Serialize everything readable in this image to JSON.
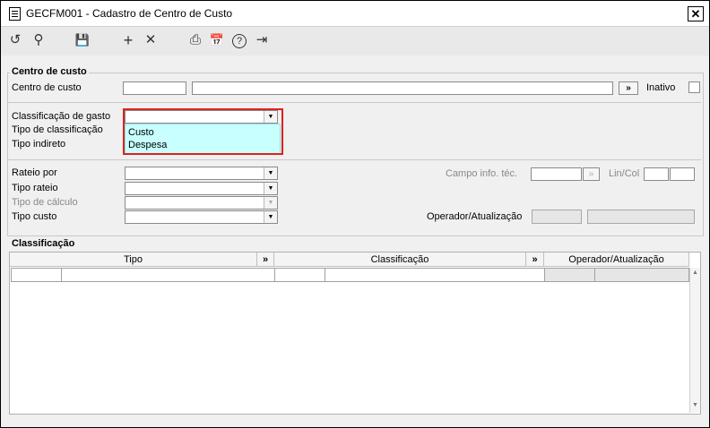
{
  "window": {
    "title": "GECFM001 - Cadastro de Centro de Custo",
    "close_label": "✕"
  },
  "toolbar": {
    "undo_icon": "↺",
    "search_icon": "⚲",
    "save_icon": "💾",
    "add_icon": "+",
    "delete_icon": "✕",
    "print_icon": "⎙",
    "calendar_icon": "📅",
    "help_icon": "?",
    "exit_icon": "⇥"
  },
  "centro": {
    "section_title": "Centro de custo",
    "label": "Centro de custo",
    "code_value": "",
    "description_value": "",
    "lookup_button": "»",
    "inativo_label": "Inativo"
  },
  "classificacao": {
    "gasto_label": "Classificação de gasto",
    "gasto_value": "",
    "tipo_label": "Tipo de classificação",
    "indireto_label": "Tipo indireto",
    "dropdown_options": [
      "Custo",
      "Despesa"
    ]
  },
  "rateio": {
    "rateio_por_label": "Rateio por",
    "tipo_rateio_label": "Tipo rateio",
    "tipo_calculo_label": "Tipo de cálculo",
    "tipo_custo_label": "Tipo custo",
    "campo_info_label": "Campo info. téc.",
    "campo_button": "»",
    "lincol_label": "Lin/Col",
    "operador_label": "Operador/Atualização"
  },
  "grid": {
    "section_title": "Classificação",
    "col_tipo": "Tipo",
    "col_lookup1": "»",
    "col_classificacao": "Classificação",
    "col_lookup2": "»",
    "col_operador": "Operador/Atualização"
  }
}
